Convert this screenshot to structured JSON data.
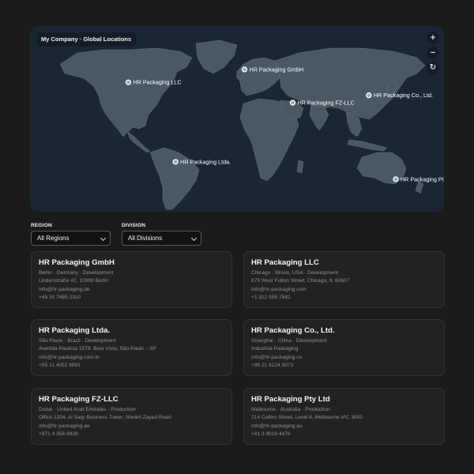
{
  "map": {
    "title": "My Company · Global Locations",
    "controls": {
      "zoom_in": "+",
      "zoom_out": "−",
      "reset": "↻"
    },
    "markers": [
      {
        "label": "HR Packaging GmbH",
        "lon": 13.4,
        "lat": 52.5
      },
      {
        "label": "HR Packaging LLC",
        "lon": -87.6,
        "lat": 41.9
      },
      {
        "label": "HR Packaging FZ-LLC",
        "lon": 55.3,
        "lat": 25.2
      },
      {
        "label": "HR Packaging Co., Ltd.",
        "lon": 121.5,
        "lat": 31.2
      },
      {
        "label": "HR Packaging Ltda.",
        "lon": -46.6,
        "lat": -23.5
      },
      {
        "label": "HR Packaging Pty Ltd",
        "lon": 144.96,
        "lat": -37.8
      }
    ],
    "colors": {
      "ocean": "#1a2733",
      "land": "#4a5864",
      "border": "#64727e",
      "marker": "#9aa8b4"
    }
  },
  "filters": {
    "region": {
      "label": "REGION",
      "selected": "All Regions"
    },
    "division": {
      "label": "DIVISION",
      "selected": "All Divisions"
    }
  },
  "locations": [
    {
      "name": "HR Packaging GmbH",
      "meta": "Berlin · Germany · Development",
      "address": "Lindenstraße 42, 10969 Berlin",
      "email": "info@hr-packaging.de",
      "phone": "+49 30 7485 2310"
    },
    {
      "name": "HR Packaging LLC",
      "meta": "Chicago · Illinois, USA · Development",
      "address": "875 West Fulton Street, Chicago, IL 60607",
      "email": "info@hr-packaging.com",
      "phone": "+1 312 555 7842"
    },
    {
      "name": "HR Packaging Ltda.",
      "meta": "São Paulo · Brazil · Development",
      "address": "Avenida Paulista 1578, Bela Vista, São Paulo – SP",
      "email": "info@hr-packaging.com.br",
      "phone": "+55 11 4052 8891"
    },
    {
      "name": "HR Packaging Co., Ltd.",
      "meta": "Shanghai · China · Development",
      "address": "Industrial Packaging",
      "email": "info@hr-packaging.cn",
      "phone": "+86 21 6124 9073"
    },
    {
      "name": "HR Packaging FZ-LLC",
      "meta": "Dubai · United Arab Emirates · Production",
      "address": "Office 1204, Al Saqr Business Tower, Sheikh Zayed Road",
      "email": "info@hr-packaging.ae",
      "phone": "+971 4 356 9928"
    },
    {
      "name": "HR Packaging Pty Ltd",
      "meta": "Melbourne · Australia · Production",
      "address": "214 Collins Street, Level 6, Melbourne VIC 3000",
      "email": "info@hr-packaging.au",
      "phone": "+61 3 9018 4476"
    }
  ]
}
